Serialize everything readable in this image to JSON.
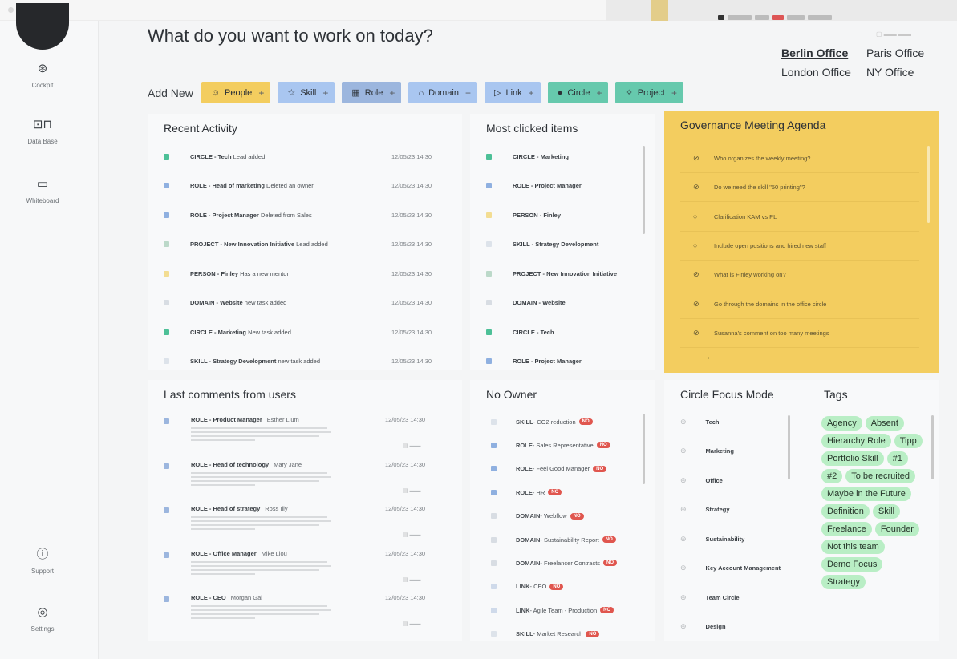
{
  "page": {
    "title": "What do you want to work on today?",
    "add_new_label": "Add New"
  },
  "offices": [
    "Berlin Office",
    "Paris Office",
    "London Office",
    "NY Office"
  ],
  "sidebar": {
    "items": [
      {
        "label": "Cockpit",
        "icon": "steering-wheel-icon"
      },
      {
        "label": "Data Base",
        "icon": "database-icon"
      },
      {
        "label": "Whiteboard",
        "icon": "monitor-icon"
      },
      {
        "label": "Support",
        "icon": "info-icon"
      },
      {
        "label": "Settings",
        "icon": "settings-icon"
      }
    ]
  },
  "add_buttons": [
    {
      "label": "People",
      "color": "#f3cd5f",
      "icon": "☺"
    },
    {
      "label": "Skill",
      "color": "#a9c6f0",
      "icon": "☆"
    },
    {
      "label": "Role",
      "color": "#9cb6de",
      "icon": "▦"
    },
    {
      "label": "Domain",
      "color": "#a9c6f0",
      "icon": "⌂"
    },
    {
      "label": "Link",
      "color": "#a9c6f0",
      "icon": "▷"
    },
    {
      "label": "Circle",
      "color": "#66c9ad",
      "icon": "●"
    },
    {
      "label": "Project",
      "color": "#66c9ad",
      "icon": "✧"
    }
  ],
  "recent_activity": {
    "title": "Recent Activity",
    "rows": [
      {
        "strong": "CIRCLE - Tech",
        "rest": " Lead added",
        "time": "12/05/23 14:30",
        "color": "#4dc097"
      },
      {
        "strong": "ROLE - Head of marketing",
        "rest": " Deleted an owner",
        "time": "12/05/23 14:30",
        "color": "#8fb0e0"
      },
      {
        "strong": "ROLE - Project Manager",
        "rest": " Deleted from Sales",
        "time": "12/05/23 14:30",
        "color": "#8fb0e0"
      },
      {
        "strong": "PROJECT - New Innovation Initiative",
        "rest": " Lead added",
        "time": "12/05/23 14:30",
        "color": "#bcd9c9"
      },
      {
        "strong": "PERSON - Finley",
        "rest": " Has a new mentor",
        "time": "12/05/23 14:30",
        "color": "#f3dd92"
      },
      {
        "strong": "DOMAIN - Website",
        "rest": " new task added",
        "time": "12/05/23 14:30",
        "color": "#d8dde3"
      },
      {
        "strong": "CIRCLE - Marketing",
        "rest": " New task added",
        "time": "12/05/23 14:30",
        "color": "#4dc097"
      },
      {
        "strong": "SKILL - Strategy Development",
        "rest": " new task added",
        "time": "12/05/23 14:30",
        "color": "#dde3ea"
      }
    ]
  },
  "most_clicked": {
    "title": "Most clicked items",
    "rows": [
      {
        "label": "CIRCLE - Marketing",
        "color": "#4dc097"
      },
      {
        "label": "ROLE - Project Manager",
        "color": "#8fb0e0"
      },
      {
        "label": "PERSON - Finley",
        "color": "#f3dd92"
      },
      {
        "label": "SKILL - Strategy Development",
        "color": "#dde3ea"
      },
      {
        "label": "PROJECT - New Innovation Initiative",
        "color": "#bcd9c9"
      },
      {
        "label": "DOMAIN - Website",
        "color": "#d8dde3"
      },
      {
        "label": "CIRCLE - Tech",
        "color": "#4dc097"
      },
      {
        "label": "ROLE - Project Manager",
        "color": "#8fb0e0"
      }
    ]
  },
  "governance": {
    "title": "Governance Meeting Agenda",
    "items": [
      {
        "text": "Who organizes the weekly meeting?",
        "done": true
      },
      {
        "text": "Do we need the skill \"50 printing\"?",
        "done": true
      },
      {
        "text": "Clarification KAM vs PL",
        "done": false
      },
      {
        "text": "Include open positions and hired new staff",
        "done": false
      },
      {
        "text": "What is Finley working on?",
        "done": true
      },
      {
        "text": "Go through the domains in the office circle",
        "done": true
      },
      {
        "text": "Susanna's comment on too many meetings",
        "done": true
      }
    ]
  },
  "comments": {
    "title": "Last comments from users",
    "rows": [
      {
        "role": "ROLE - Product Manager",
        "user": "Esther Lium",
        "time": "12/05/23 14:30"
      },
      {
        "role": "ROLE - Head of technology",
        "user": "Mary Jane",
        "time": "12/05/23 14:30"
      },
      {
        "role": "ROLE - Head of strategy",
        "user": "Ross Illy",
        "time": "12/05/23 14:30"
      },
      {
        "role": "ROLE - Office Manager",
        "user": "Mike Liou",
        "time": "12/05/23 14:30"
      },
      {
        "role": "ROLE - CEO",
        "user": "Morgan Gal",
        "time": "12/05/23 14:30"
      }
    ]
  },
  "no_owner": {
    "title": "No Owner",
    "badge": "NO",
    "rows": [
      {
        "strong": "SKILL",
        "rest": " - CO2 reduction",
        "color": "#dde3ea"
      },
      {
        "strong": "ROLE",
        "rest": " - Sales Representative",
        "color": "#8fb0e0"
      },
      {
        "strong": "ROLE",
        "rest": " - Feel Good Manager",
        "color": "#8fb0e0"
      },
      {
        "strong": "ROLE",
        "rest": " - HR",
        "color": "#8fb0e0"
      },
      {
        "strong": "DOMAIN",
        "rest": " - Webflow",
        "color": "#d8dde3"
      },
      {
        "strong": "DOMAIN",
        "rest": " - Sustainability Report",
        "color": "#d8dde3"
      },
      {
        "strong": "DOMAIN",
        "rest": " - Freelancer Contracts",
        "color": "#d8dde3"
      },
      {
        "strong": "LINK",
        "rest": " - CEO",
        "color": "#cfdaea"
      },
      {
        "strong": "LINK",
        "rest": " - Agile Team - Production",
        "color": "#cfdaea"
      },
      {
        "strong": "SKILL",
        "rest": " - Market Research",
        "color": "#dde3ea"
      }
    ]
  },
  "circle_focus": {
    "title": "Circle Focus Mode",
    "rows": [
      "Tech",
      "Marketing",
      "Office",
      "Strategy",
      "Sustainability",
      "Key Account Management",
      "Team Circle",
      "Design"
    ]
  },
  "tags": {
    "title": "Tags",
    "items": [
      "Agency",
      "Absent",
      "Hierarchy Role",
      "Tipp",
      "Portfolio Skill",
      "#1",
      "#2",
      "To be recruited",
      "Maybe in the Future",
      "Definition",
      "Skill",
      "Freelance",
      "Founder",
      "Not this team",
      "Demo Focus",
      "Strategy"
    ]
  }
}
